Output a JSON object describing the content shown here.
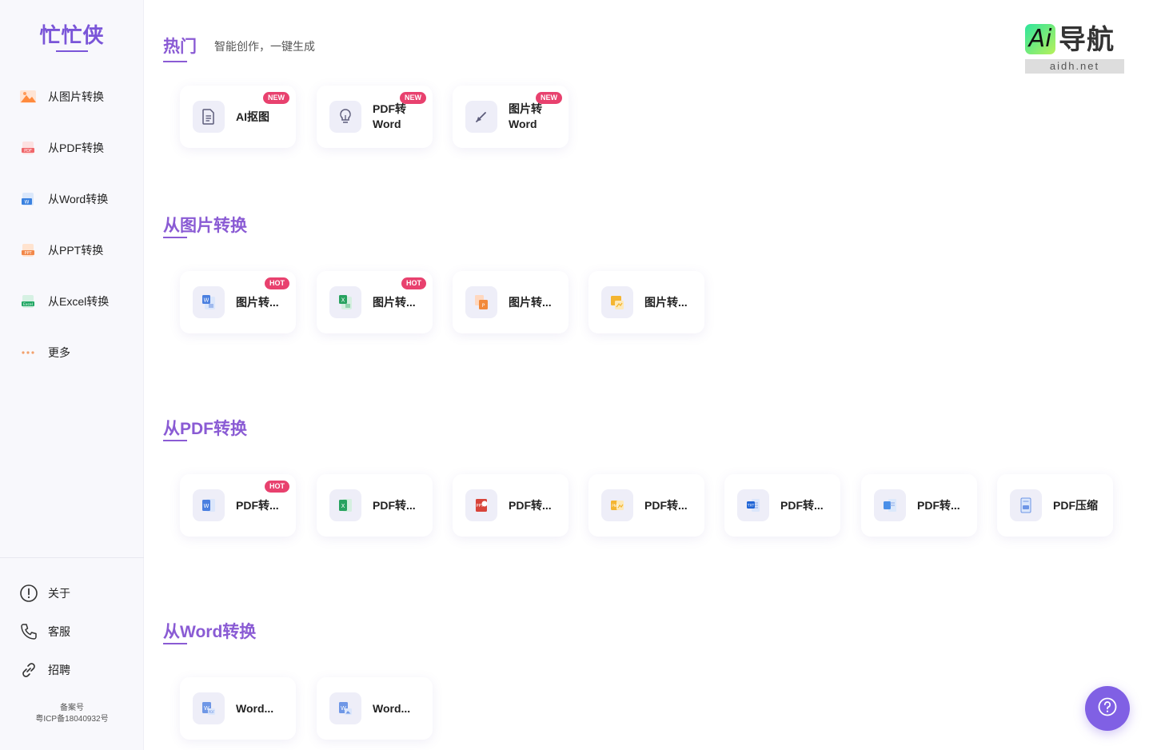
{
  "brand": {
    "logo": "忙忙侠"
  },
  "sidebar": {
    "items": [
      {
        "label": "从图片转换",
        "icon": "image-icon"
      },
      {
        "label": "从PDF转换",
        "icon": "pdf-file-icon"
      },
      {
        "label": "从Word转换",
        "icon": "word-file-icon"
      },
      {
        "label": "从PPT转换",
        "icon": "ppt-file-icon"
      },
      {
        "label": "从Excel转换",
        "icon": "excel-file-icon"
      },
      {
        "label": "更多",
        "icon": "more-dots-icon"
      }
    ],
    "footer": [
      {
        "label": "关于",
        "icon": "info-icon"
      },
      {
        "label": "客服",
        "icon": "phone-icon"
      },
      {
        "label": "招聘",
        "icon": "link-icon"
      }
    ],
    "icp_line1": "备案号",
    "icp_line2": "粤ICP备18040932号"
  },
  "sections": {
    "hot": {
      "title": "热门",
      "subtitle": "智能创作，一键生成",
      "cards": [
        {
          "label": "AI抠图",
          "badge": "NEW",
          "icon": "document-icon"
        },
        {
          "label": "PDF转Word",
          "line1": "PDF转",
          "line2": "Word",
          "badge": "NEW",
          "icon": "lightbulb-icon"
        },
        {
          "label": "图片转Word",
          "line1": "图片转",
          "line2": "Word",
          "badge": "NEW",
          "icon": "pen-icon"
        }
      ]
    },
    "image": {
      "title": "从图片转换",
      "cards": [
        {
          "label": "图片转...",
          "badge": "HOT",
          "icon": "image-to-word-icon"
        },
        {
          "label": "图片转...",
          "badge": "HOT",
          "icon": "image-to-excel-icon"
        },
        {
          "label": "图片转...",
          "badge": "",
          "icon": "image-to-ppt-icon"
        },
        {
          "label": "图片转...",
          "badge": "",
          "icon": "image-to-pdf-icon"
        }
      ]
    },
    "pdf": {
      "title": "从PDF转换",
      "cards": [
        {
          "label": "PDF转...",
          "badge": "HOT",
          "icon": "pdf-to-word-icon"
        },
        {
          "label": "PDF转...",
          "badge": "",
          "icon": "pdf-to-excel-icon"
        },
        {
          "label": "PDF转...",
          "badge": "",
          "icon": "pdf-to-ppt-icon"
        },
        {
          "label": "PDF转...",
          "badge": "",
          "icon": "pdf-to-image-icon"
        },
        {
          "label": "PDF转...",
          "badge": "",
          "icon": "pdf-to-txt-icon"
        },
        {
          "label": "PDF转...",
          "badge": "",
          "icon": "pdf-to-html-icon"
        },
        {
          "label": "PDF压缩",
          "badge": "",
          "icon": "pdf-compress-icon"
        }
      ]
    },
    "word": {
      "title": "从Word转换",
      "cards": [
        {
          "label": "Word...",
          "badge": "",
          "icon": "word-to-pdf-icon"
        },
        {
          "label": "Word...",
          "badge": "",
          "icon": "word-to-image-icon"
        }
      ]
    }
  },
  "watermark": {
    "brand": "Ai",
    "name": "导航",
    "url": "aidh.net"
  },
  "help_button": {
    "icon": "question-icon"
  },
  "colors": {
    "accent": "#8a5bd4",
    "badge": "#e8416e",
    "help": "#8060e4"
  }
}
